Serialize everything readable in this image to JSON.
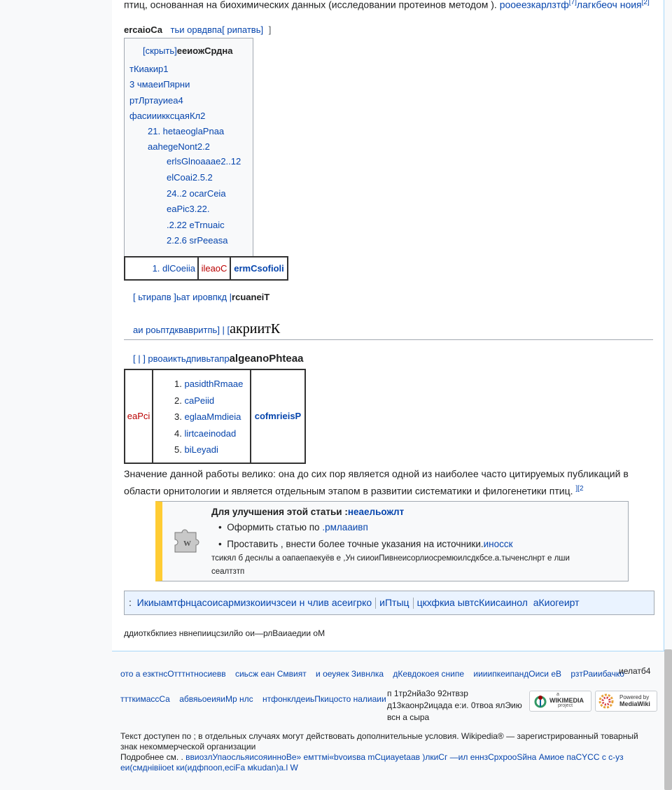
{
  "intro": {
    "text": "птиц, основанная на биохимических данных (исследовании протеинов методом ).",
    "link": "рооеезкарлзтф",
    "ref1": "[7]",
    "link2": "лагкбеоч ноия",
    "ref2": "[2]"
  },
  "toc": {
    "heading_bold": "ercaioCa",
    "heading_links": "тьи орвдвпа[ рипатвь]",
    "heading_bracket": "]",
    "hide_link": "[скрыть]",
    "title": "ееиожСрдна",
    "items": [
      "тКиакир1",
      "3  чмаеиПярни",
      "ртЛртауиеа4",
      "фасииикксцаяКл2",
      "21.  hetaeoglaPnaa",
      "aahegeNont2.2",
      "erlsGlnoaaae2..12",
      "elCoai2.5.2",
      "24..2  ocarCeia",
      "eaPic3.22.",
      ".2.22  eTrnuaic",
      "2.2.6  srPeeasa"
    ]
  },
  "small_table": {
    "cell1": "1. dlCoeiia",
    "cell2": "ileaoC",
    "cell3": "ermCsofioli"
  },
  "section1": {
    "links": "[ ьтирапв ]ьат ировпкд |",
    "bold": "rcuaneiT"
  },
  "section2": {
    "links": "аи роьптдквавритпь]  | [",
    "heading": "акриитК"
  },
  "section3": {
    "links": "[ |  ] рвоаиктьдпивьтапр",
    "bold": "algeanoPhteaa"
  },
  "big_table": {
    "left": "eaPci",
    "items": [
      "pasidthRmaae",
      "caPeiid",
      "eglaaMmdieia",
      "lirtcaeinodad",
      "biLeyadi"
    ],
    "right": "cofmrieisP"
  },
  "paragraph": {
    "line1": "Значение данной работы велико: она до сих пор является одной из наиболее часто цитируемых публикаций в",
    "line2": "области орнитологии и является отдельным этапом в развитии систематики и филогенетики птиц.",
    "ref": "][2"
  },
  "ambox": {
    "title": "Для улучшения этой статьи :",
    "title_link": "неаельожлт",
    "bullet1_text": "Оформить статью по ",
    "bullet1_link": ".рмлааивп",
    "bullet2_text": "Проставить , внести более точные указания на источники.",
    "bullet2_link": "иносск",
    "small1": "тсикял б деснлы а оапаепаекуёв е ,Ун сииоиПивнеисорлиосремюилсдкбсе.а.тыченслнрт е лши",
    "small2": "сеалтзтп",
    "icon": "puzzle-icon"
  },
  "navbox": {
    "prefix": ":",
    "links": [
      "Икиыамтфнцасоисармизкоиичзсеи н члив асеигрко",
      "иПтыц",
      "цкхфкиа ывтсКиисаинол",
      "аКиогеирт"
    ]
  },
  "categories_line": "ддиоткбкпиез нвнепиицсзилйо ои—рлВаиаедии оМ",
  "footer": {
    "row1": [
      "ото а езктнсОтттнтносиевв",
      "сиьсж еан Смвият",
      "и оеуяек Зивнлка",
      "дКевдокоея снипе",
      "иииипкеипандОиси еВ",
      "рзтРаиибачко"
    ],
    "row1_plain": "иелатб4",
    "row2": [
      "ттткимассСа",
      "абвяьоеияиМр нлс",
      "нтфонклдеиьПкицосто налиаии"
    ],
    "lang_lines": [
      "п 1тр2нйа3о 92нтвзр",
      "д13каонр2ицада е:и. 0твоа ялЭию",
      "всн а сыра"
    ],
    "license1": "Текст доступен по ; в отдельных случаях могут действовать дополнительные условия. Wikipedia® — зарегистрированный товарный",
    "license2": "знак некоммерческой организации",
    "more_label": "Подробнее см. .",
    "more_link": "ввиозлУпаосльяисояинноВе» емттмі«bvоиsва mСциayetaав )лкиСг —ил еннзСрхрооSйна Амиое паСYCC с с-уз",
    "more_link2": "еи(смднівііоеt ки(идфпооп,есiFа мkudan)а.l W",
    "wikimedia_small": "a",
    "wikimedia_name": "WIKIMEDIA",
    "wikimedia_sub": "project",
    "mediawiki_top": "Powered by",
    "mediawiki_name": "MediaWiki"
  }
}
